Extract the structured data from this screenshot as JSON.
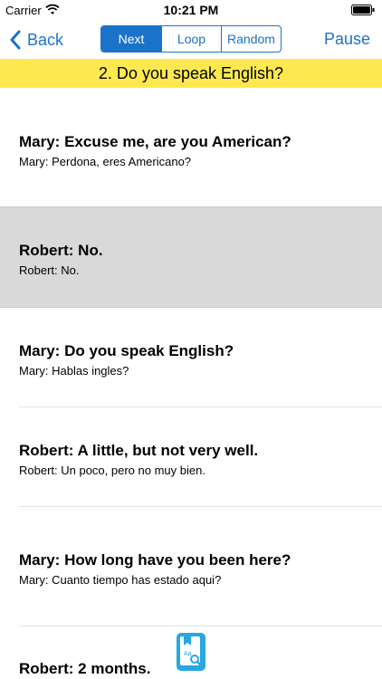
{
  "status": {
    "carrier": "Carrier",
    "time": "10:21 PM"
  },
  "nav": {
    "back_label": "Back",
    "segments": [
      {
        "label": "Next",
        "active": true
      },
      {
        "label": "Loop",
        "active": false
      },
      {
        "label": "Random",
        "active": false
      }
    ],
    "pause_label": "Pause"
  },
  "title": "2. Do you speak English?",
  "rows": [
    {
      "main": "Mary: Excuse me, are you American?",
      "sub": "Mary: Perdona, eres Americano?",
      "highlighted": false
    },
    {
      "main": "Robert: No.",
      "sub": "Robert: No.",
      "highlighted": true
    },
    {
      "main": "Mary: Do you speak English?",
      "sub": "Mary: Hablas ingles?",
      "highlighted": false
    },
    {
      "main": "Robert: A little, but not very well.",
      "sub": "Robert: Un poco, pero no muy bien.",
      "highlighted": false
    },
    {
      "main": "Mary: How long have you been here?",
      "sub": "Mary: Cuanto tiempo has estado aqui?",
      "highlighted": false
    },
    {
      "main": "Robert: 2 months.",
      "sub": "",
      "highlighted": false
    }
  ],
  "colors": {
    "accent": "#1a73c9",
    "title_bg": "#fde94f",
    "highlight_bg": "#d9d9d9"
  },
  "icons": {
    "dictionary": "dictionary-search-icon"
  }
}
